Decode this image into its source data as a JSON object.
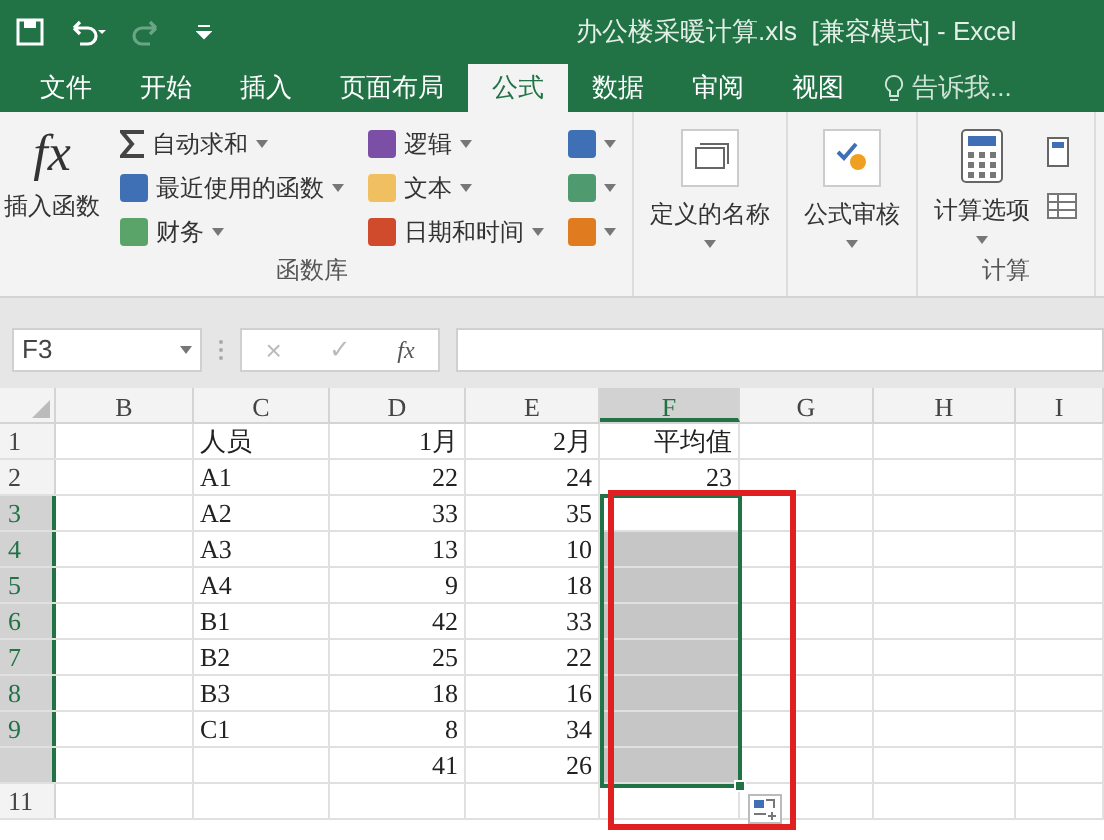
{
  "window": {
    "title": "办公楼采暖计算.xls  [兼容模式] - Excel"
  },
  "tabs": [
    {
      "label": "文件",
      "selected": false
    },
    {
      "label": "开始",
      "selected": false
    },
    {
      "label": "插入",
      "selected": false
    },
    {
      "label": "页面布局",
      "selected": false
    },
    {
      "label": "公式",
      "selected": true
    },
    {
      "label": "数据",
      "selected": false
    },
    {
      "label": "审阅",
      "selected": false
    },
    {
      "label": "视图",
      "selected": false
    }
  ],
  "tell_me": {
    "placeholder": "告诉我..."
  },
  "ribbon": {
    "insert_function": {
      "symbol": "fx",
      "label": "插入函数"
    },
    "function_columns": [
      [
        {
          "label": "自动求和",
          "kind": "sum"
        },
        {
          "label": "最近使用的函数",
          "kind": "box",
          "color": "#3f6fb5"
        },
        {
          "label": "财务",
          "kind": "box",
          "color": "#5aa46a"
        }
      ],
      [
        {
          "label": "逻辑",
          "kind": "box",
          "color": "#7b4fa6"
        },
        {
          "label": "文本",
          "kind": "box",
          "color": "#f0c060"
        },
        {
          "label": "日期和时间",
          "kind": "box",
          "color": "#d04a2c"
        }
      ],
      [
        {
          "kind": "box",
          "color": "#3f6fb5"
        },
        {
          "kind": "box",
          "color": "#4f9a6e"
        },
        {
          "kind": "box",
          "color": "#e07b20"
        }
      ]
    ],
    "function_group": "函数库",
    "big_buttons": [
      {
        "label": "定义的名称",
        "kind": "names"
      },
      {
        "label": "公式审核",
        "kind": "audit"
      }
    ],
    "calc": {
      "label": "计算选项",
      "group": "计算"
    }
  },
  "name_box": "F3",
  "formula_bar": {
    "cancel": "×",
    "enter": "✓",
    "function": "fx"
  },
  "columns": [
    {
      "label": "B",
      "selected": false
    },
    {
      "label": "C",
      "selected": false
    },
    {
      "label": "D",
      "selected": false
    },
    {
      "label": "E",
      "selected": false
    },
    {
      "label": "F",
      "selected": true
    },
    {
      "label": "G",
      "selected": false
    },
    {
      "label": "H",
      "selected": false
    },
    {
      "label": "I",
      "selected": false
    }
  ],
  "rows": [
    {
      "header": "1",
      "selected": false,
      "cells": [
        "",
        "人员",
        "1月",
        "2月",
        "平均值",
        "",
        "",
        ""
      ]
    },
    {
      "header": "2",
      "selected": false,
      "cells": [
        "",
        "A1",
        "22",
        "24",
        "23",
        "",
        "",
        ""
      ]
    },
    {
      "header": "3",
      "selected": true,
      "cells": [
        "",
        "A2",
        "33",
        "35",
        "",
        "",
        "",
        ""
      ]
    },
    {
      "header": "4",
      "selected": true,
      "cells": [
        "",
        "A3",
        "13",
        "10",
        "",
        "",
        "",
        ""
      ]
    },
    {
      "header": "5",
      "selected": true,
      "cells": [
        "",
        "A4",
        "9",
        "18",
        "",
        "",
        "",
        ""
      ]
    },
    {
      "header": "6",
      "selected": true,
      "cells": [
        "",
        "B1",
        "42",
        "33",
        "",
        "",
        "",
        ""
      ]
    },
    {
      "header": "7",
      "selected": true,
      "cells": [
        "",
        "B2",
        "25",
        "22",
        "",
        "",
        "",
        ""
      ]
    },
    {
      "header": "8",
      "selected": true,
      "cells": [
        "",
        "B3",
        "18",
        "16",
        "",
        "",
        "",
        ""
      ]
    },
    {
      "header": "9",
      "selected": true,
      "cells": [
        "",
        "C1",
        "8",
        "34",
        "",
        "",
        "",
        ""
      ]
    },
    {
      "header": "",
      "selected": true,
      "cells": [
        "",
        "",
        "41",
        "26",
        "",
        "",
        "",
        ""
      ]
    },
    {
      "header": "11",
      "selected": false,
      "cells": [
        "",
        "",
        "",
        "",
        "",
        "",
        "",
        ""
      ]
    }
  ],
  "annotation": {
    "kind": "box"
  }
}
